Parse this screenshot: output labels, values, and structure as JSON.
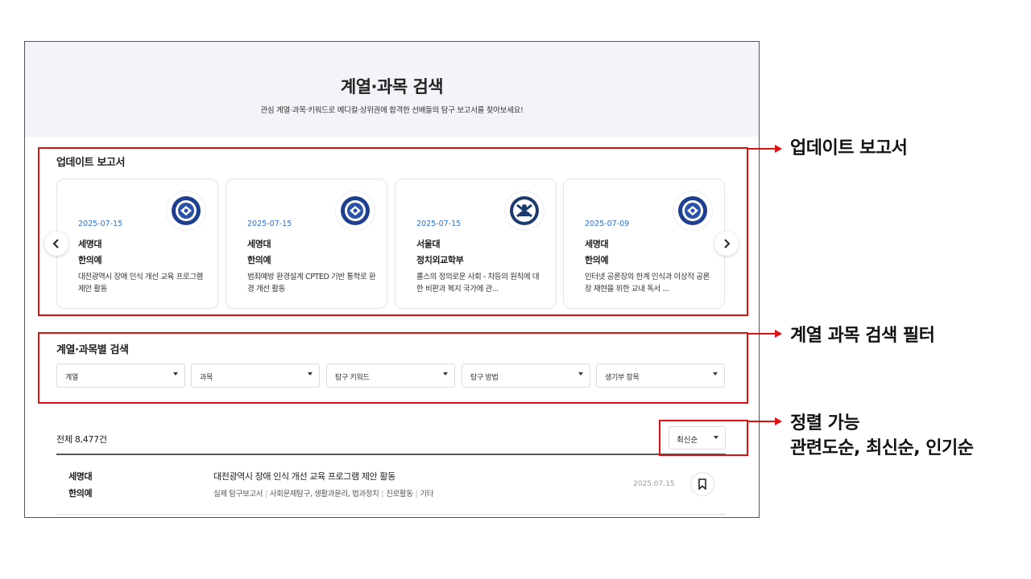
{
  "hero": {
    "title": "계열·과목 검색",
    "subtitle": "관심 계열·과목·키워드로 메디컬·상위권에 합격한 선배들의 탐구 보고서를 찾아보세요!"
  },
  "updates": {
    "title": "업데이트 보고서",
    "cards": [
      {
        "date": "2025-07-15",
        "university": "세명대",
        "department": "한의예",
        "summary": "대전광역시 장애 인식 개선 교육 프로그램 제안 활동",
        "logo_icon": "semyung-emblem"
      },
      {
        "date": "2025-07-15",
        "university": "세명대",
        "department": "한의예",
        "summary": "범죄예방 환경설계 CPTED 기반 통학로 환경 개선 활동",
        "logo_icon": "semyung-emblem"
      },
      {
        "date": "2025-07-15",
        "university": "서울대",
        "department": "정치외교학부",
        "summary": "롤스의 정의로운 사회 - 차등의 원칙에 대한 비판과 복지 국가에 관...",
        "logo_icon": "snu-emblem"
      },
      {
        "date": "2025-07-09",
        "university": "세명대",
        "department": "한의예",
        "summary": "인터넷 공론장의 한계 인식과 이상적 공론장 재현을 위한 교내 독서 ...",
        "logo_icon": "semyung-emblem"
      }
    ]
  },
  "filters": {
    "title": "계열·과목별 검색",
    "selects": [
      "계열",
      "과목",
      "탐구 키워드",
      "탐구 방법",
      "생기부 항목"
    ]
  },
  "results": {
    "total": "전체 8,477건",
    "sort": "최신순",
    "rows": [
      {
        "university": "세명대",
        "department": "한의예",
        "title": "대전광역시 장애 인식 개선 교육 프로그램 제안 활동",
        "tags": [
          "실제 탐구보고서",
          "사회문제탐구, 생활과윤리, 법과정치",
          "진로활동",
          "기타"
        ],
        "date": "2025.07.15"
      }
    ]
  },
  "annotations": {
    "updates": "업데이트 보고서",
    "filters": "계열 과목 검색 필터",
    "sort_line1": "정렬 가능",
    "sort_line2": "관련도순, 최신순, 인기순"
  },
  "colors": {
    "accent": "#2f6fd6",
    "annotation": "#e01010",
    "hero_bg": "#f3f4f7"
  }
}
